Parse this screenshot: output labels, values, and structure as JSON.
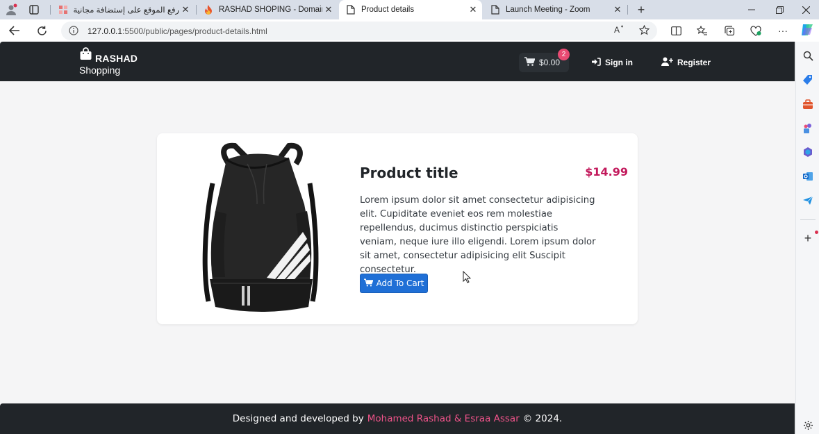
{
  "browser": {
    "tabs": [
      {
        "title": "رفع الموقع على إستضافة مجانية و",
        "active": false,
        "icon": "grid-favicon-icon"
      },
      {
        "title": "RASHAD SHOPING - Domains -",
        "active": false,
        "icon": "flame-favicon-icon"
      },
      {
        "title": "Product details",
        "active": true,
        "icon": "page-icon"
      },
      {
        "title": "Launch Meeting - Zoom",
        "active": false,
        "icon": "page-icon"
      }
    ],
    "url_host": "127.0.0.1",
    "url_path": ":5500/public/pages/product-details.html"
  },
  "navbar": {
    "brand_name": "RASHAD",
    "brand_sub": "Shopping",
    "cart_total": "$0.00",
    "cart_count": "2",
    "signin_label": "Sign in",
    "register_label": "Register"
  },
  "product": {
    "title": "Product title",
    "price": "$14.99",
    "description": "Lorem ipsum dolor sit amet consectetur adipisicing elit. Cupiditate eveniet eos rem molestiae repellendus, ducimus distinctio perspiciatis veniam, neque iure illo eligendi. Lorem ipsum dolor sit amet, consectetur adipisicing elit Suscipit consectetur.",
    "add_to_cart_label": "Add To Cart"
  },
  "footer": {
    "prefix": "Designed and developed by",
    "authors": "Mohamed Rashad & Esraa Assar",
    "suffix": "© 2024."
  },
  "colors": {
    "navbar_bg": "#212529",
    "price": "#c2185b",
    "button": "#1f6fd6",
    "badge": "#e84a72",
    "author_link": "#f0538a"
  }
}
